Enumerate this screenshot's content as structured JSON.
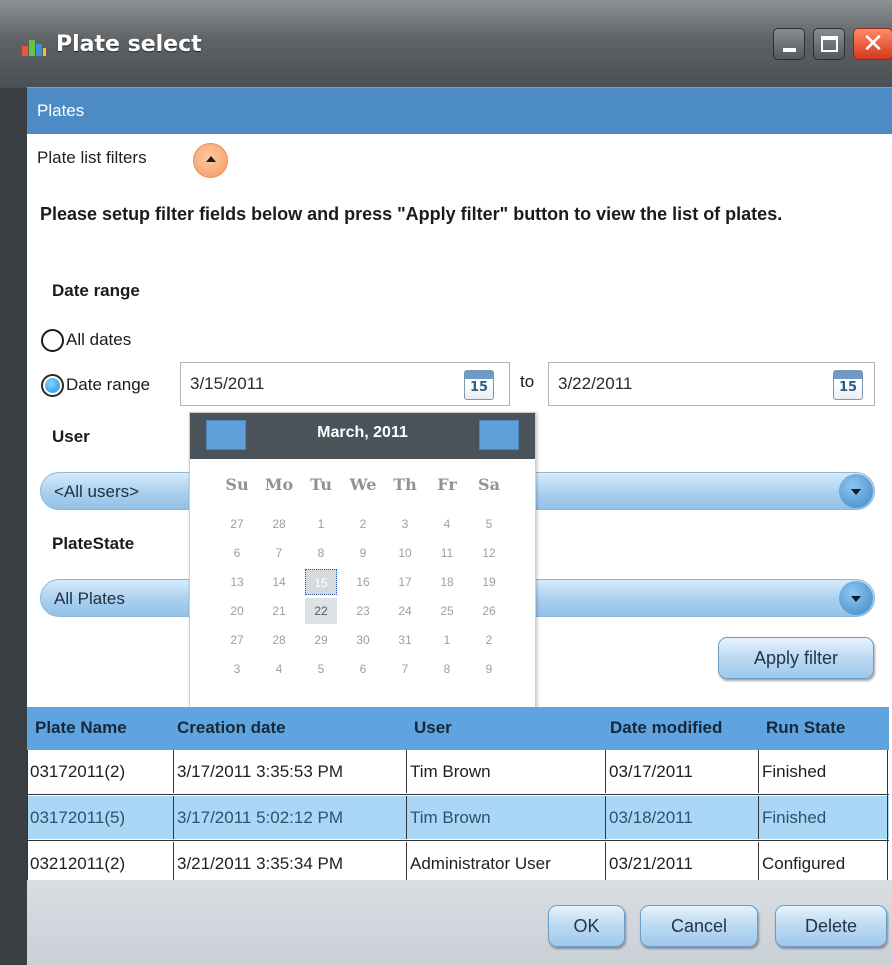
{
  "window": {
    "title": "Plate select",
    "colors": {
      "titlebar": "#5f6366",
      "close": "#d2391c"
    }
  },
  "panel": {
    "header": "Plates",
    "filters_label": "Plate list filters",
    "instructions": "Please setup filter fields below and press \"Apply filter\" button to view the list of plates.",
    "date_range_section": "Date range",
    "all_dates_label": "All dates",
    "date_range_label": "Date range",
    "date_range_selected": "Date range",
    "from_date": "3/15/2011",
    "to_label": "to",
    "to_date": "3/22/2011",
    "calendar_icon_day": "15",
    "user_section": "User",
    "user_value": "<All users>",
    "platestate_section": "PlateState",
    "platestate_value": "All Plates",
    "apply_filter": "Apply filter"
  },
  "calendar": {
    "title": "March, 2011",
    "weekdays": [
      "Su",
      "Mo",
      "Tu",
      "We",
      "Th",
      "Fr",
      "Sa"
    ],
    "weeks": [
      [
        "27",
        "28",
        "1",
        "2",
        "3",
        "4",
        "5"
      ],
      [
        "6",
        "7",
        "8",
        "9",
        "10",
        "11",
        "12"
      ],
      [
        "13",
        "14",
        "15",
        "16",
        "17",
        "18",
        "19"
      ],
      [
        "20",
        "21",
        "22",
        "23",
        "24",
        "25",
        "26"
      ],
      [
        "27",
        "28",
        "29",
        "30",
        "31",
        "1",
        "2"
      ],
      [
        "3",
        "4",
        "5",
        "6",
        "7",
        "8",
        "9"
      ]
    ],
    "selected_day": "15",
    "highlighted_day": "22"
  },
  "table": {
    "columns": [
      "Plate Name",
      "Creation date",
      "User",
      "Date modified",
      "Run State"
    ],
    "rows": [
      [
        "03172011(2)",
        "3/17/2011 3:35:53 PM",
        "Tim Brown",
        "03/17/2011",
        "Finished"
      ],
      [
        "03172011(5)",
        "3/17/2011 5:02:12 PM",
        "Tim Brown",
        "03/18/2011",
        "Finished"
      ],
      [
        "03212011(2)",
        "3/21/2011 3:35:34 PM",
        "Administrator User",
        "03/21/2011",
        "Configured"
      ]
    ],
    "selected_row": 1
  },
  "footer": {
    "ok": "OK",
    "cancel": "Cancel",
    "delete": "Delete"
  }
}
